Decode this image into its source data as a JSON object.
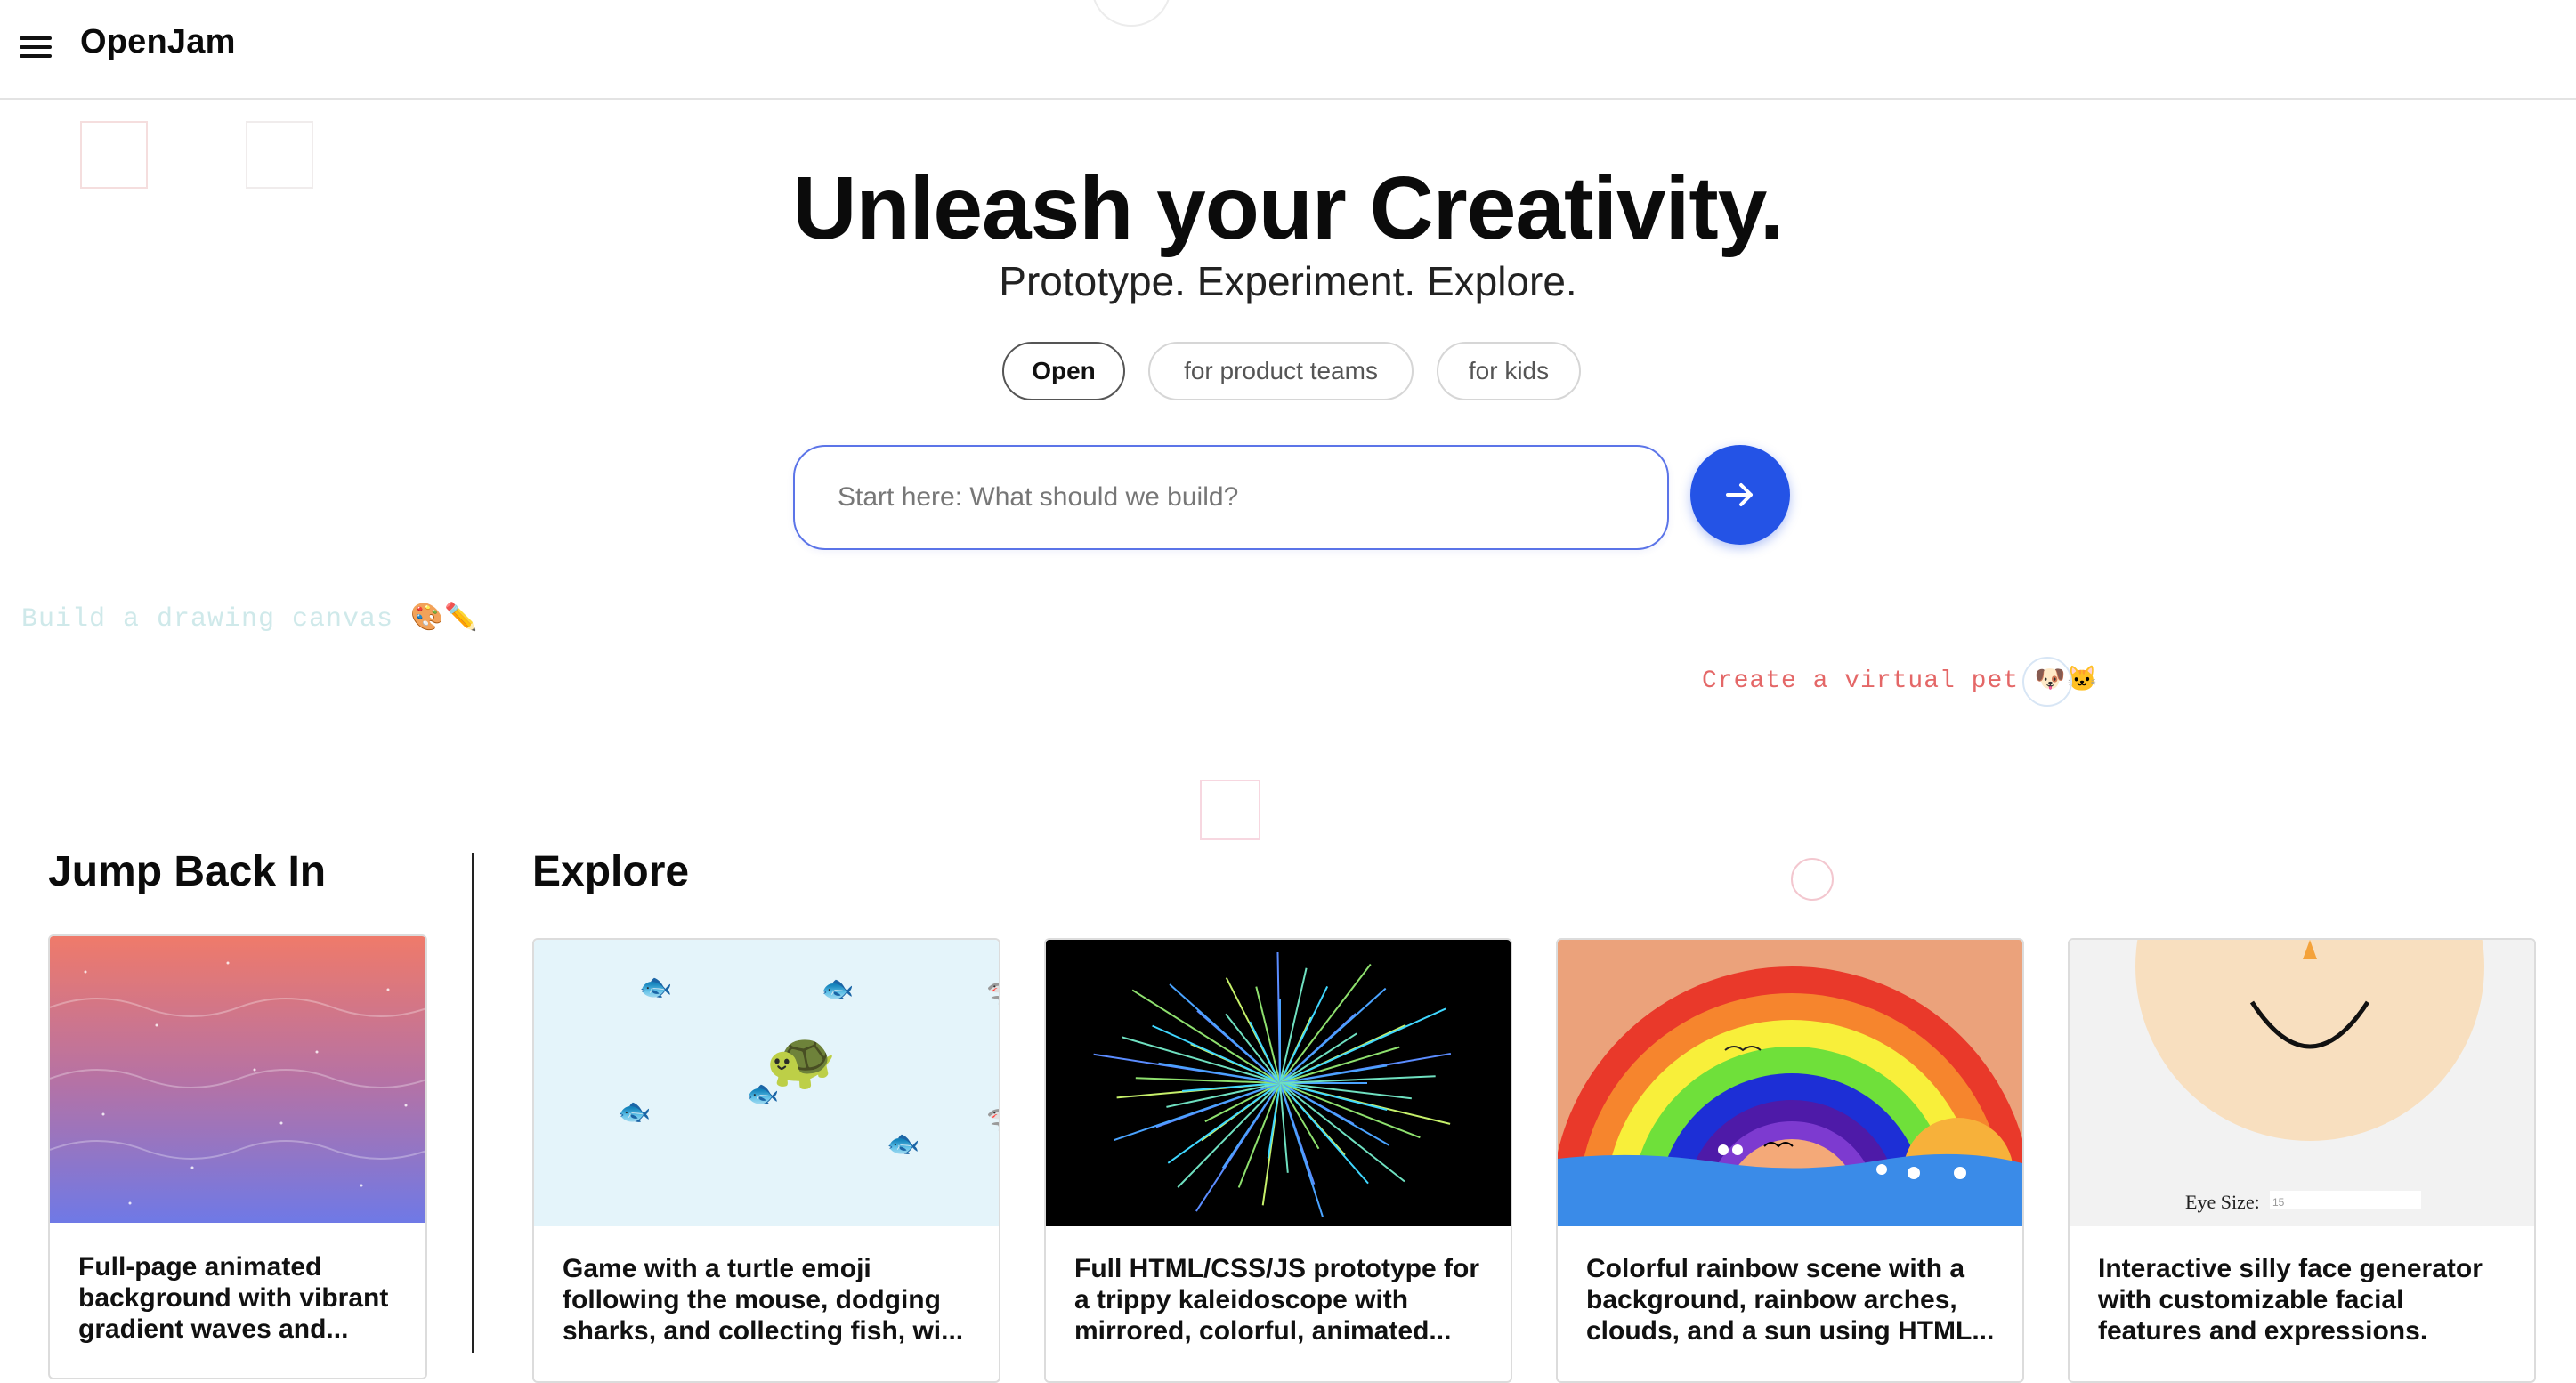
{
  "app": {
    "title": "OpenJam"
  },
  "hero": {
    "title": "Unleash your Creativity.",
    "subtitle": "Prototype. Experiment. Explore."
  },
  "modes": [
    {
      "label": "Open",
      "active": true
    },
    {
      "label": "for product teams",
      "active": false
    },
    {
      "label": "for kids",
      "active": false
    }
  ],
  "search": {
    "placeholder": "Start here: What should we build?",
    "value": ""
  },
  "floating_prompts": [
    "Build a drawing canvas 🎨✏️",
    "Create a virtual pet 🐶🐱"
  ],
  "sections": {
    "jump_back_in": "Jump Back In",
    "explore": "Explore"
  },
  "recent_cards": [
    {
      "description": "Full-page animated background with vibrant gradient waves and..."
    }
  ],
  "explore_cards": [
    {
      "description": "Game with a turtle emoji following the mouse, dodging sharks, and collecting fish, wi..."
    },
    {
      "description": "Full HTML/CSS/JS prototype for a trippy kaleidoscope with mirrored, colorful, animated..."
    },
    {
      "description": "Colorful rainbow scene with a background, rainbow arches, clouds, and a sun using HTML..."
    },
    {
      "description": "Interactive silly face generator with customizable facial features and expressions."
    }
  ],
  "thumb_labels": {
    "eye_size": "Eye Size:",
    "eye_size_value": "15"
  },
  "colors": {
    "accent": "#2453e6",
    "search_border": "#5b74e8"
  }
}
